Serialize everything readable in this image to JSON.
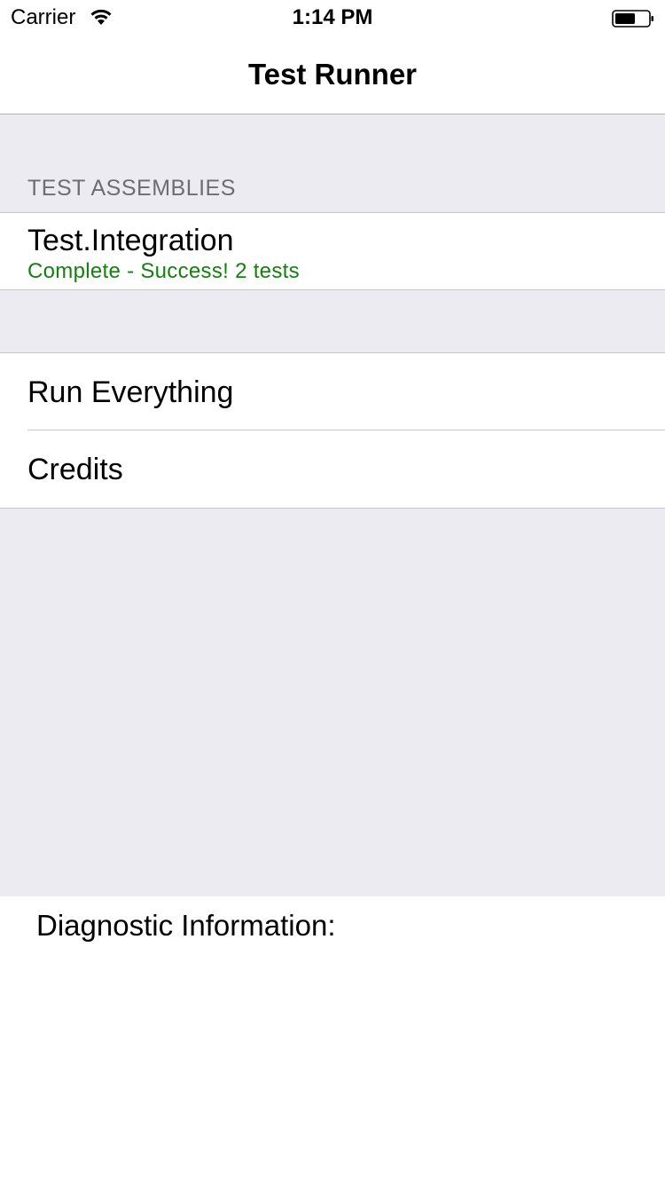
{
  "status_bar": {
    "carrier": "Carrier",
    "time": "1:14 PM",
    "wifi_icon": "wifi-icon",
    "battery_icon": "battery-icon"
  },
  "nav": {
    "title": "Test Runner"
  },
  "sections": {
    "assemblies_header": "TEST ASSEMBLIES",
    "assemblies": [
      {
        "name": "Test.Integration",
        "status": "Complete - Success! 2 tests"
      }
    ],
    "actions": [
      {
        "label": "Run Everything"
      },
      {
        "label": "Credits"
      }
    ]
  },
  "diagnostics": {
    "label": "Diagnostic Information:"
  },
  "colors": {
    "success": "#158010",
    "grouped_background": "#ebebf1",
    "section_header": "#6d6d72",
    "separator": "#c8c7cc"
  }
}
